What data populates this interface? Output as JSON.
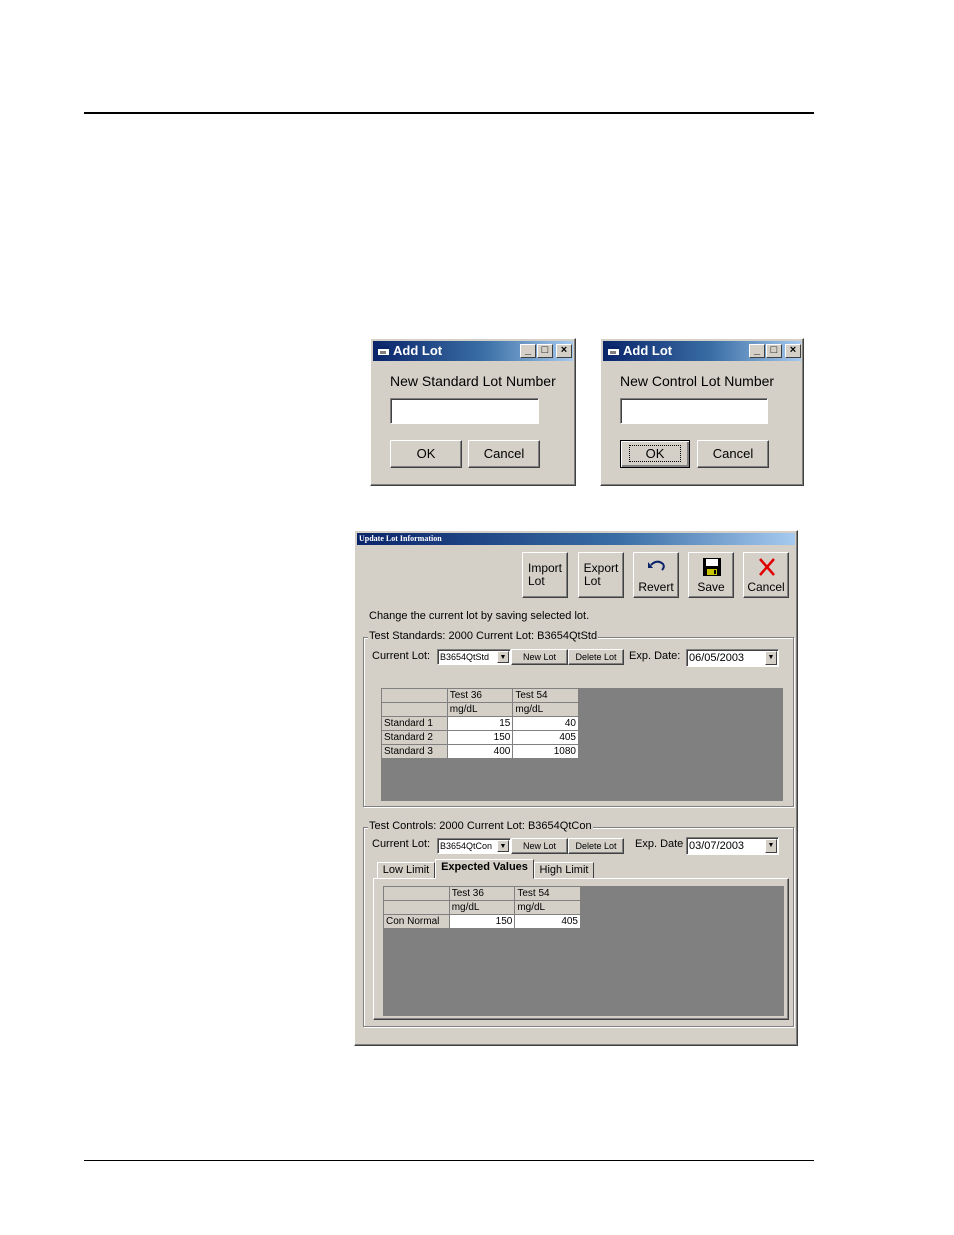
{
  "dialog_standard": {
    "title": "Add Lot",
    "label": "New Standard Lot Number",
    "input_value": "",
    "ok_label": "OK",
    "cancel_label": "Cancel"
  },
  "dialog_control": {
    "title": "Add Lot",
    "label": "New Control Lot Number",
    "input_value": "",
    "ok_label": "OK",
    "cancel_label": "Cancel"
  },
  "update_lot": {
    "title": "Update Lot Information",
    "toolbar": {
      "import_label_1": "Import",
      "import_label_2": "Lot",
      "export_label_1": "Export",
      "export_label_2": "Lot",
      "revert_label": "Revert",
      "save_label": "Save",
      "cancel_label": "Cancel"
    },
    "instruction": "Change the current lot by saving selected lot.",
    "standards": {
      "group_label": "Test Standards: 2000 Current Lot: B3654QtStd",
      "current_lot_label": "Current Lot:",
      "current_lot_value": "B3654QtStd",
      "new_lot_label": "New Lot",
      "delete_lot_label": "Delete Lot",
      "exp_date_label": "Exp. Date:",
      "exp_date_value": "06/05/2003",
      "columns": [
        "Test 36",
        "Test 54"
      ],
      "units": [
        "mg/dL",
        "mg/dL"
      ],
      "rows": [
        {
          "name": "Standard 1",
          "values": [
            "15",
            "40"
          ]
        },
        {
          "name": "Standard 2",
          "values": [
            "150",
            "405"
          ]
        },
        {
          "name": "Standard 3",
          "values": [
            "400",
            "1080"
          ]
        }
      ]
    },
    "controls": {
      "group_label": "Test Controls: 2000 Current Lot: B3654QtCon",
      "current_lot_label": "Current Lot:",
      "current_lot_value": "B3654QtCon",
      "new_lot_label": "New Lot",
      "delete_lot_label": "Delete Lot",
      "exp_date_label": "Exp. Date",
      "exp_date_value": "03/07/2003",
      "tabs": [
        "Low Limit",
        "Expected Values",
        "High Limit"
      ],
      "active_tab": "Expected Values",
      "columns": [
        "Test 36",
        "Test 54"
      ],
      "units": [
        "mg/dL",
        "mg/dL"
      ],
      "rows": [
        {
          "name": "Con Normal",
          "values": [
            "150",
            "405"
          ]
        }
      ]
    }
  },
  "colors": {
    "window_bg": "#d4d0c8",
    "title_gradient_start": "#0a246a",
    "grid_bg": "#808080",
    "cancel_x": "#e00000"
  }
}
